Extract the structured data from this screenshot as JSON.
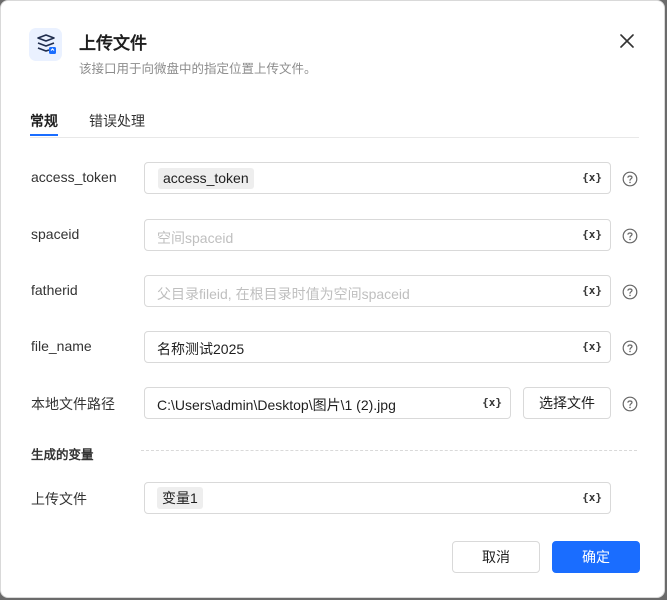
{
  "dialog": {
    "title": "上传文件",
    "subtitle": "该接口用于向微盘中的指定位置上传文件。",
    "app_icon": "upload-box-icon",
    "close_icon": "close-icon",
    "accent_color": "#1a6dff"
  },
  "tabs": [
    {
      "label": "常规",
      "active": true
    },
    {
      "label": "错误处理",
      "active": false
    }
  ],
  "fields": {
    "access_token": {
      "label": "access_token",
      "value": "access_token",
      "placeholder": ""
    },
    "spaceid": {
      "label": "spaceid",
      "value": "",
      "placeholder": "空间spaceid"
    },
    "fatherid": {
      "label": "fatherid",
      "value": "",
      "placeholder": "父目录fileid, 在根目录时值为空间spaceid"
    },
    "file_name": {
      "label": "file_name",
      "value": "名称测试2025",
      "placeholder": ""
    },
    "local_path": {
      "label": "本地文件路径",
      "value": "C:\\Users\\admin\\Desktop\\图片\\1 (2).jpg",
      "placeholder": ""
    }
  },
  "var_button_label": "{x}",
  "select_file_label": "选择文件",
  "output": {
    "section_title": "生成的变量",
    "label": "上传文件",
    "value": "变量1"
  },
  "footer": {
    "cancel_label": "取消",
    "ok_label": "确定"
  }
}
